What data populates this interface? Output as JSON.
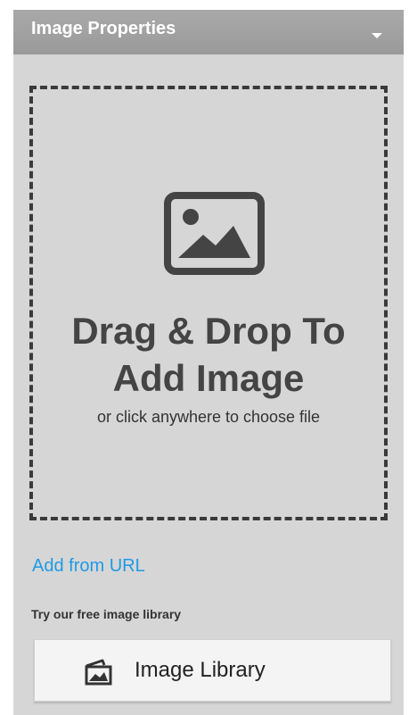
{
  "header": {
    "title": "Image Properties",
    "collapse_icon": "chevron-down-icon"
  },
  "dropzone": {
    "icon": "image-icon",
    "title_line1": "Drag & Drop To",
    "title_line2": "Add Image",
    "subtitle": "or click anywhere to choose file"
  },
  "url_link": {
    "label": "Add from URL"
  },
  "library": {
    "prompt": "Try our free image library",
    "button_label": "Image Library",
    "button_icon": "image-library-icon"
  },
  "colors": {
    "panel_bg": "#d6d6d6",
    "header_bg": "#a3a3a3",
    "link": "#1e9ae6",
    "text_dark": "#444444"
  }
}
